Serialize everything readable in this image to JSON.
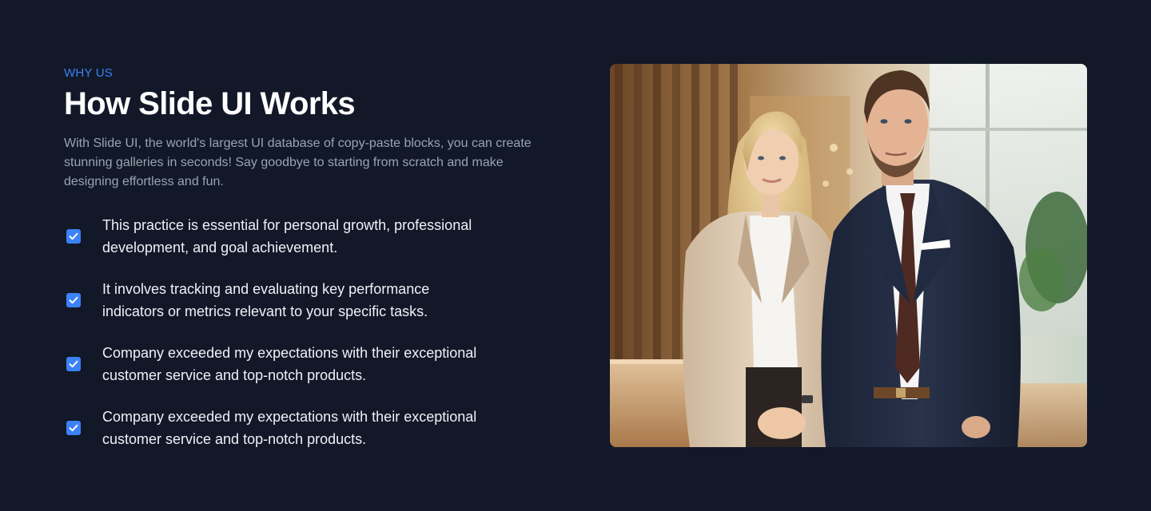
{
  "section": {
    "eyebrow": "WHY US",
    "title": "How Slide UI Works",
    "description": "With Slide UI, the world's largest UI database of copy-paste blocks, you can create stunning galleries in seconds! Say goodbye to starting from scratch and make designing effortless and fun."
  },
  "features": [
    {
      "text": "This practice is essential for personal growth, professional development, and goal achievement."
    },
    {
      "text": "It involves tracking and evaluating key performance indicators or metrics relevant to your specific tasks."
    },
    {
      "text": "Company exceeded my expectations with their exceptional customer service and top-notch products."
    },
    {
      "text": "Company exceeded my expectations with their exceptional customer service and top-notch products."
    }
  ],
  "icons": {
    "feature_check": "checkbox-checked-icon"
  },
  "colors": {
    "background": "#121828",
    "accent": "#3b82f6",
    "heading": "#ffffff",
    "body_text": "#9aa3b2",
    "feature_text": "#eef1f6"
  }
}
